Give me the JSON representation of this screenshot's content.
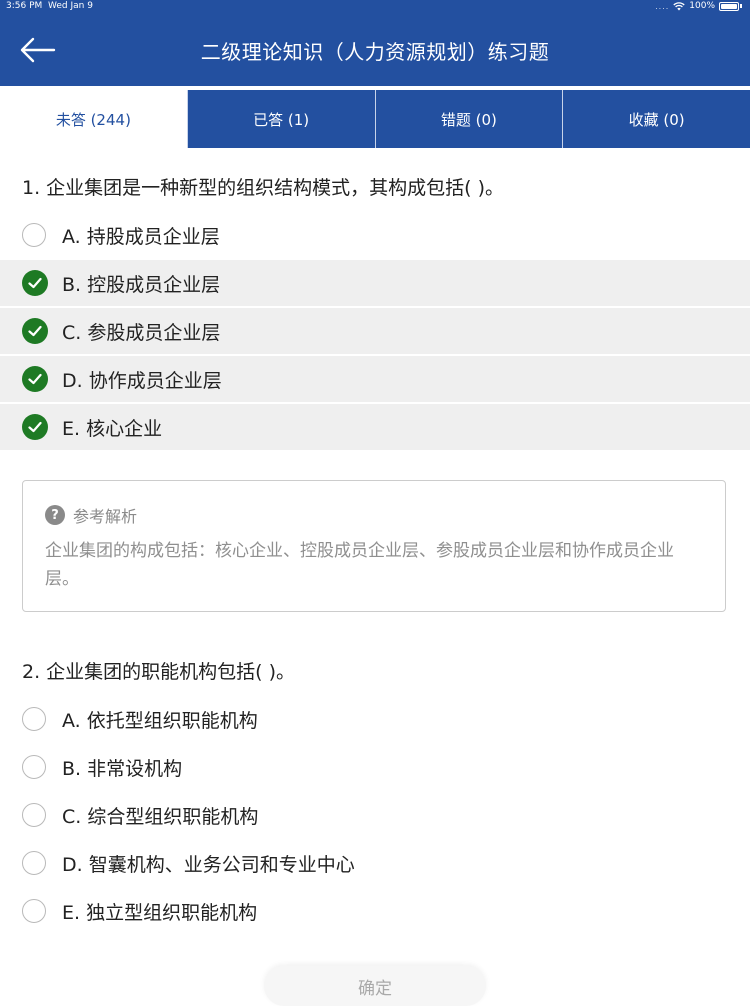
{
  "status_bar": {
    "time": "3:56 PM",
    "date": "Wed Jan 9",
    "signal_dots": "....",
    "battery": "100%"
  },
  "header": {
    "title": "二级理论知识（人力资源规划）练习题"
  },
  "tabs": [
    {
      "label": "未答 (244)"
    },
    {
      "label": "已答 (1)"
    },
    {
      "label": "错题 (0)"
    },
    {
      "label": "收藏 (0)"
    }
  ],
  "questions": [
    {
      "title": "1. 企业集团是一种新型的组织结构模式，其构成包括(    )。",
      "options": [
        {
          "label": "A. 持股成员企业层"
        },
        {
          "label": "B. 控股成员企业层"
        },
        {
          "label": "C. 参股成员企业层"
        },
        {
          "label": "D. 协作成员企业层"
        },
        {
          "label": "E. 核心企业"
        }
      ]
    },
    {
      "title": "2. 企业集团的职能机构包括(    )。",
      "options": [
        {
          "label": "A. 依托型组织职能机构"
        },
        {
          "label": "B. 非常设机构"
        },
        {
          "label": "C. 综合型组织职能机构"
        },
        {
          "label": "D. 智囊机构、业务公司和专业中心"
        },
        {
          "label": "E. 独立型组织职能机构"
        }
      ]
    }
  ],
  "analysis": {
    "icon": "?",
    "heading": "参考解析",
    "text": "企业集团的构成包括：核心企业、控股成员企业层、参股成员企业层和协作成员企业层。"
  },
  "confirm_label": "确定",
  "colors": {
    "brand": "#2350a0",
    "check": "#1e7a24",
    "selected_bg": "#efefef"
  }
}
